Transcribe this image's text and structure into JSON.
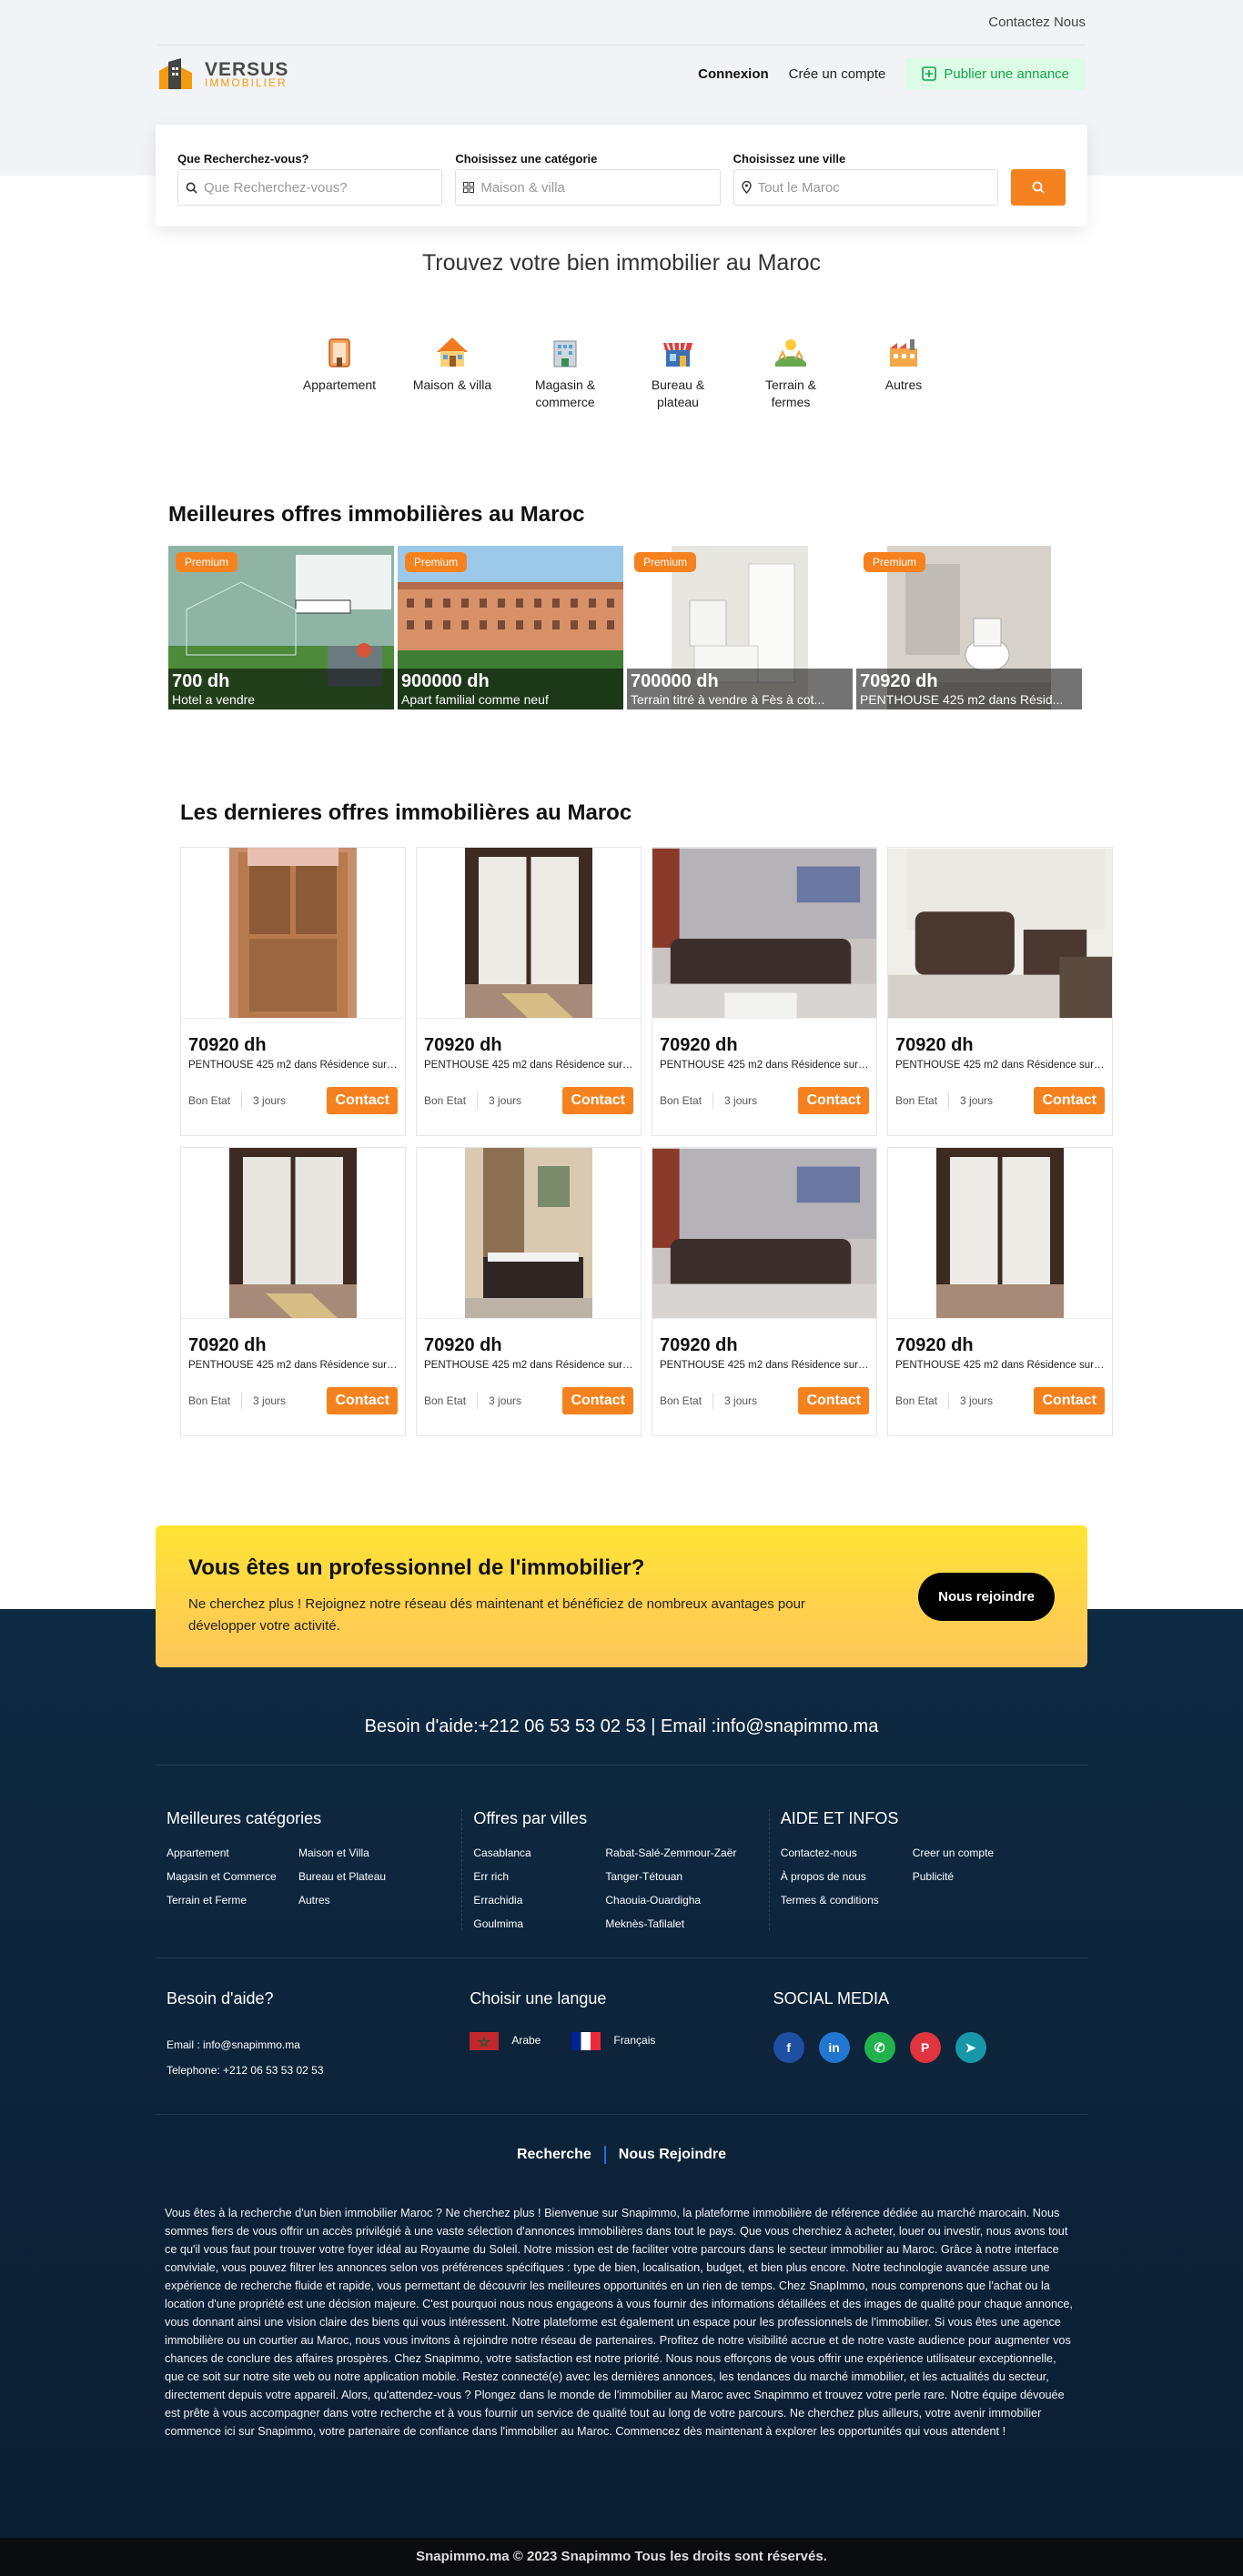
{
  "header": {
    "contact": "Contactez Nous",
    "logo_top": "VERSUS",
    "logo_bottom": "IMMOBILIER",
    "login": "Connexion",
    "create": "Crée un compte",
    "publish": "Publier une annance"
  },
  "search": {
    "q_label": "Que Recherchez-vous?",
    "q_placeholder": "Que Recherchez-vous?",
    "cat_label": "Choisissez une catégorie",
    "cat_value": "Maison & villa",
    "city_label": "Choisissez une ville",
    "city_value": "Tout le Maroc"
  },
  "hero_title": "Trouvez votre bien immobilier au Maroc",
  "categories": [
    {
      "label": "Appartement",
      "icon": "building-icon"
    },
    {
      "label": "Maison & villa",
      "icon": "house-icon"
    },
    {
      "label": "Magasin & commerce",
      "icon": "store-icon"
    },
    {
      "label": "Bureau & plateau",
      "icon": "office-icon"
    },
    {
      "label": "Terrain & fermes",
      "icon": "farm-icon"
    },
    {
      "label": "Autres",
      "icon": "factory-icon"
    }
  ],
  "premium": {
    "title": "Meilleures offres immobilières au Maroc",
    "items": [
      {
        "badge": "Premium",
        "price": "700 dh",
        "label": "Hotel a vendre"
      },
      {
        "badge": "Premium",
        "price": "900000 dh",
        "label": "Apart familial comme neuf"
      },
      {
        "badge": "Premium",
        "price": "700000 dh",
        "label": "Terrain titré à vendre à Fès à cot..."
      },
      {
        "badge": "Premium",
        "price": "70920 dh",
        "label": "PENTHOUSE 425 m2 dans Résid..."
      }
    ]
  },
  "latest": {
    "title": "Les dernieres offres immobilières au Maroc",
    "items": [
      {
        "price": "70920 dh",
        "desc": "PENTHOUSE 425 m2 dans Résidence surv...",
        "state": "Bon Etat",
        "age": "3 jours",
        "cta": "Contact"
      },
      {
        "price": "70920 dh",
        "desc": "PENTHOUSE 425 m2 dans Résidence surv...",
        "state": "Bon Etat",
        "age": "3 jours",
        "cta": "Contact"
      },
      {
        "price": "70920 dh",
        "desc": "PENTHOUSE 425 m2 dans Résidence surv...",
        "state": "Bon Etat",
        "age": "3 jours",
        "cta": "Contact"
      },
      {
        "price": "70920 dh",
        "desc": "PENTHOUSE 425 m2 dans Résidence surv...",
        "state": "Bon Etat",
        "age": "3 jours",
        "cta": "Contact"
      },
      {
        "price": "70920 dh",
        "desc": "PENTHOUSE 425 m2 dans Résidence surv...",
        "state": "Bon Etat",
        "age": "3 jours",
        "cta": "Contact"
      },
      {
        "price": "70920 dh",
        "desc": "PENTHOUSE 425 m2 dans Résidence surv...",
        "state": "Bon Etat",
        "age": "3 jours",
        "cta": "Contact"
      },
      {
        "price": "70920 dh",
        "desc": "PENTHOUSE 425 m2 dans Résidence surv...",
        "state": "Bon Etat",
        "age": "3 jours",
        "cta": "Contact"
      },
      {
        "price": "70920 dh",
        "desc": "PENTHOUSE 425 m2 dans Résidence surv...",
        "state": "Bon Etat",
        "age": "3 jours",
        "cta": "Contact"
      }
    ]
  },
  "pro": {
    "title": "Vous êtes un professionnel de l'immobilier?",
    "text": "Ne cherchez plus ! Rejoignez notre réseau dés maintenant et bénéficiez de nombreux avantages pour développer votre activité.",
    "cta": "Nous rejoindre"
  },
  "footer": {
    "help": "Besoin d'aide:+212 06 53 53 02 53 | Email :info@snapimmo.ma",
    "col1": {
      "title": "Meilleures catégories",
      "links": [
        "Appartement",
        "Maison et Villa",
        "Magasin et Commerce",
        "Bureau et Plateau",
        "Terrain et Ferme",
        "Autres"
      ]
    },
    "col2": {
      "title": "Offres par villes",
      "links": [
        "Casablanca",
        "Rabat-Salé-Zemmour-Zaër",
        "Err rich",
        "Tanger-Tétouan",
        "Errachidia",
        "Chaouia-Ouardigha",
        "Goulmima",
        "Meknès-Tafilalet"
      ]
    },
    "col3": {
      "title": "AIDE ET INFOS",
      "links": [
        "Contactez-nous",
        "Creer un compte",
        "À propos de nous",
        "Publicité",
        "Termes & conditions",
        ""
      ]
    },
    "need_help": "Besoin d'aide?",
    "email": "Email : info@snapimmo.ma",
    "phone": "Telephone: +212 06 53 53 02 53",
    "lang_title": "Choisir une langue",
    "lang_ar": "Arabe",
    "lang_fr": "Français",
    "social_title": "SOCIAL MEDIA",
    "nav_search": "Recherche",
    "nav_join": "Nous Rejoindre",
    "about": "Vous êtes à la recherche d'un bien immobilier Maroc ? Ne cherchez plus ! Bienvenue sur Snapimmo, la plateforme immobilière de référence dédiée au marché marocain. Nous sommes fiers de vous offrir un accès privilégié à une vaste sélection d'annonces immobilières dans tout le pays. Que vous cherchiez à acheter, louer ou investir, nous avons tout ce qu'il vous faut pour trouver votre foyer idéal au Royaume du Soleil. Notre mission est de faciliter votre parcours dans le secteur immobilier au Maroc. Grâce à notre interface conviviale, vous pouvez filtrer les annonces selon vos préférences spécifiques : type de bien, localisation, budget, et bien plus encore. Notre technologie avancée assure une expérience de recherche fluide et rapide, vous permettant de découvrir les meilleures opportunités en un rien de temps. Chez SnapImmo, nous comprenons que l'achat ou la location d'une propriété est une décision majeure. C'est pourquoi nous nous engageons à vous fournir des informations détaillées et des images de qualité pour chaque annonce, vous donnant ainsi une vision claire des biens qui vous intéressent. Notre plateforme est également un espace pour les professionnels de l'immobilier. Si vous êtes une agence immobilière ou un courtier au Maroc, nous vous invitons à rejoindre notre réseau de partenaires. Profitez de notre visibilité accrue et de notre vaste audience pour augmenter vos chances de conclure des affaires prospères. Chez Snapimmo, votre satisfaction est notre priorité. Nous nous efforçons de vous offrir une expérience utilisateur exceptionnelle, que ce soit sur notre site web ou notre application mobile. Restez connecté(e) avec les dernières annonces, les tendances du marché immobilier, et les actualités du secteur, directement depuis votre appareil. Alors, qu'attendez-vous ? Plongez dans le monde de l'immobilier au Maroc avec Snapimmo et trouvez votre perle rare. Notre équipe dévouée est prête à vous accompagner dans votre recherche et à vous fournir un service de qualité tout au long de votre parcours. Ne cherchez plus ailleurs, votre avenir immobilier commence ici sur Snapimmo, votre partenaire de confiance dans l'immobilier au Maroc. Commencez dès maintenant à explorer les opportunités qui vous attendent !",
    "copyright": "Snapimmo.ma © 2023 Snapimmo Tous les droits sont réservés."
  },
  "colors": {
    "accent": "#f6821f",
    "footer_bg": "#0e2a43",
    "publish_bg": "#dcfce7"
  }
}
